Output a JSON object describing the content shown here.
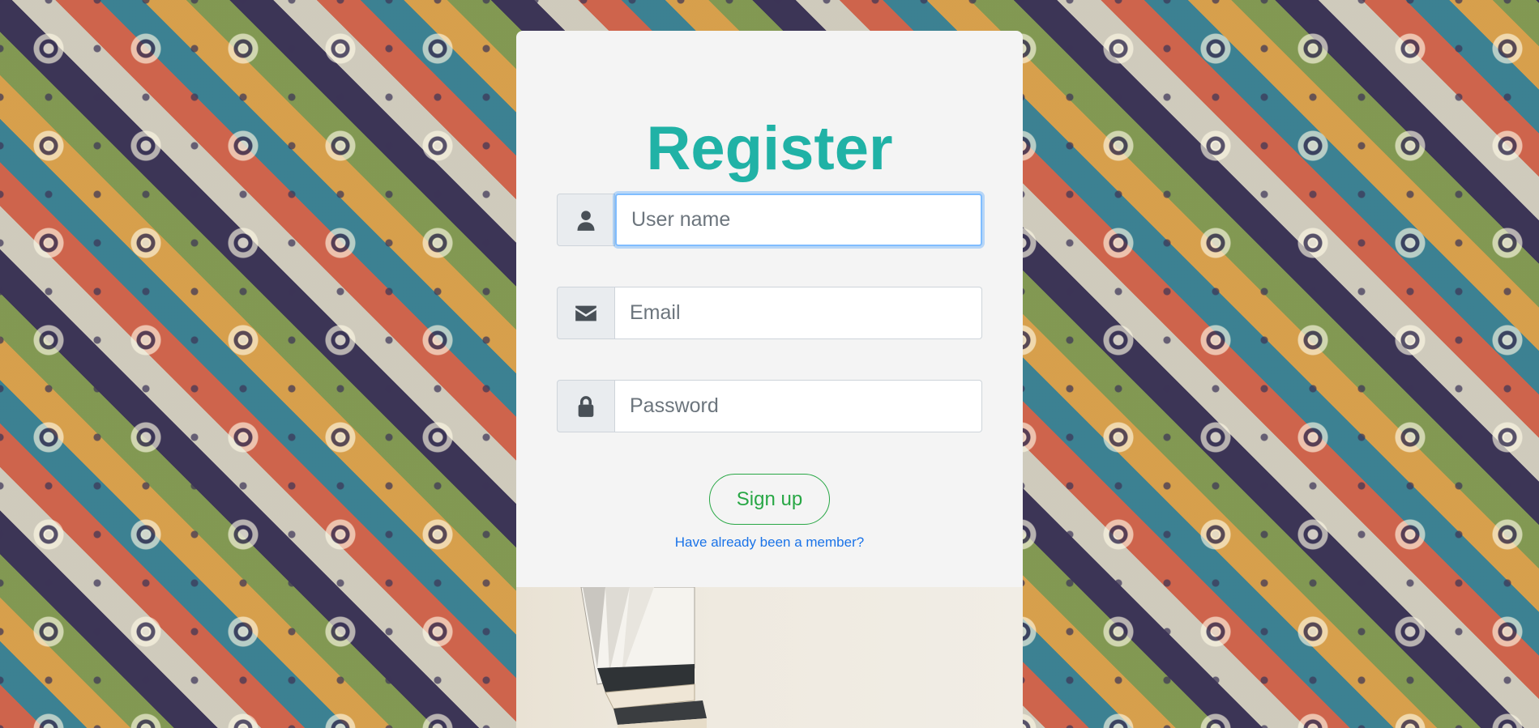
{
  "form": {
    "title": "Register",
    "username_placeholder": "User name",
    "email_placeholder": "Email",
    "password_placeholder": "Password",
    "signup_label": "Sign up",
    "member_link": "Have already been a member?"
  },
  "icons": {
    "username": "user-icon",
    "email": "envelope-icon",
    "password": "lock-icon"
  },
  "colors": {
    "title": "#20b2a6",
    "signup": "#28a745",
    "link": "#1a73e8",
    "card": "#f4f4f4"
  }
}
